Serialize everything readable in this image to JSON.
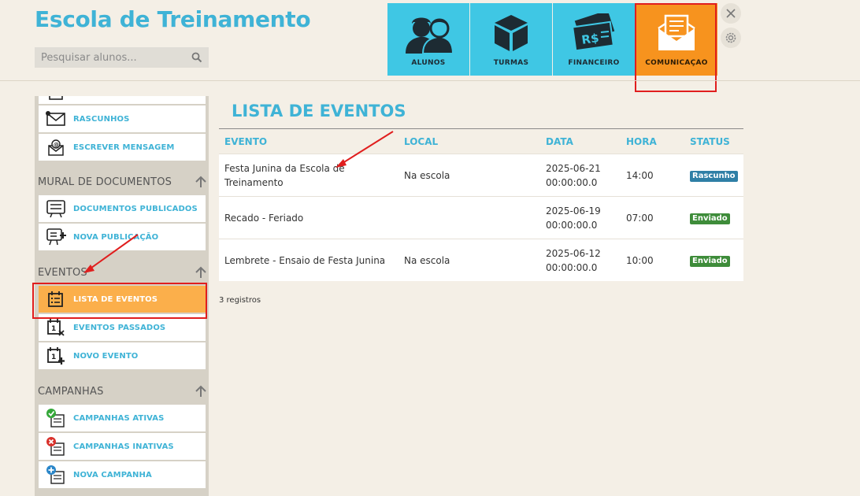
{
  "app": {
    "title": "Escola de Treinamento"
  },
  "search": {
    "placeholder": "Pesquisar alunos..."
  },
  "modules": [
    {
      "label": "ALUNOS",
      "icon": "students-icon",
      "active": false
    },
    {
      "label": "TURMAS",
      "icon": "box-icon",
      "active": false
    },
    {
      "label": "FINANCEIRO",
      "icon": "money-icon",
      "active": false
    },
    {
      "label": "COMUNICAÇAO",
      "icon": "envelope-icon",
      "active": true
    }
  ],
  "colors": {
    "accent": "#3fb3d6",
    "module_bg": "#3fc7e4",
    "module_active": "#f7931e",
    "sidebar_active": "#fbaf4b",
    "highlight": "#e01e1e",
    "badge_draft": "#2f7fa6",
    "badge_sent": "#3e8c3a"
  },
  "sidebar": {
    "items_top": [
      {
        "label": "RASCUNHOS",
        "icon": "draft-envelope-icon"
      },
      {
        "label": "ESCREVER MENSAGEM",
        "icon": "write-message-icon"
      }
    ],
    "sections": [
      {
        "title": "MURAL DE DOCUMENTOS",
        "items": [
          {
            "label": "DOCUMENTOS PUBLICADOS",
            "icon": "board-list-icon"
          },
          {
            "label": "NOVA PUBLICAÇÃO",
            "icon": "board-add-icon"
          }
        ]
      },
      {
        "title": "EVENTOS",
        "items": [
          {
            "label": "LISTA DE EVENTOS",
            "icon": "calendar-list-icon",
            "active": true
          },
          {
            "label": "EVENTOS PASSADOS",
            "icon": "calendar-past-icon"
          },
          {
            "label": "NOVO EVENTO",
            "icon": "calendar-add-icon"
          }
        ]
      },
      {
        "title": "CAMPANHAS",
        "items": [
          {
            "label": "CAMPANHAS ATIVAS",
            "icon": "campaign-active-icon"
          },
          {
            "label": "CAMPANHAS INATIVAS",
            "icon": "campaign-inactive-icon"
          },
          {
            "label": "NOVA CAMPANHA",
            "icon": "campaign-add-icon"
          }
        ]
      }
    ]
  },
  "main": {
    "title": "LISTA DE EVENTOS",
    "columns": [
      "EVENTO",
      "LOCAL",
      "DATA",
      "HORA",
      "STATUS"
    ],
    "rows": [
      {
        "evento_line1": "Festa Junina da Escola de",
        "evento_line2": "Treinamento",
        "local": "Na escola",
        "data_line1": "2025-06-21",
        "data_line2": "00:00:00.0",
        "hora": "14:00",
        "status": "Rascunho"
      },
      {
        "evento_line1": "Recado - Feriado",
        "evento_line2": "",
        "local": "",
        "data_line1": "2025-06-19",
        "data_line2": "00:00:00.0",
        "hora": "07:00",
        "status": "Enviado"
      },
      {
        "evento_line1": "Lembrete - Ensaio de Festa Junina",
        "evento_line2": "",
        "local": "Na escola",
        "data_line1": "2025-06-12",
        "data_line2": "00:00:00.0",
        "hora": "10:00",
        "status": "Enviado"
      }
    ],
    "records": "3 registros"
  }
}
